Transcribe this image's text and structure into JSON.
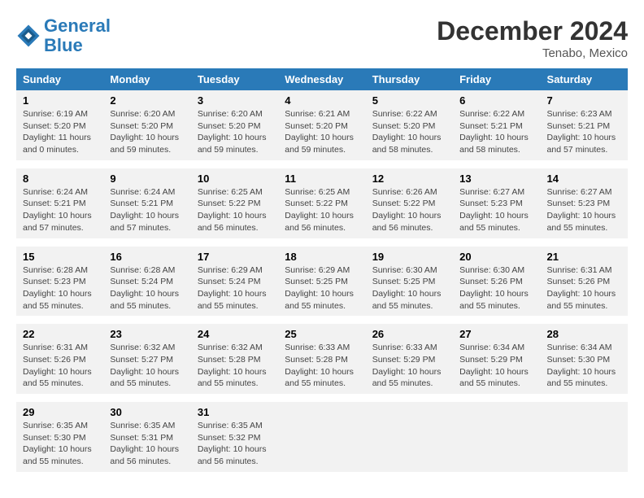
{
  "header": {
    "logo_line1": "General",
    "logo_line2": "Blue",
    "month": "December 2024",
    "location": "Tenabo, Mexico"
  },
  "weekdays": [
    "Sunday",
    "Monday",
    "Tuesday",
    "Wednesday",
    "Thursday",
    "Friday",
    "Saturday"
  ],
  "weeks": [
    [
      {
        "day": "1",
        "info": "Sunrise: 6:19 AM\nSunset: 5:20 PM\nDaylight: 11 hours\nand 0 minutes."
      },
      {
        "day": "2",
        "info": "Sunrise: 6:20 AM\nSunset: 5:20 PM\nDaylight: 10 hours\nand 59 minutes."
      },
      {
        "day": "3",
        "info": "Sunrise: 6:20 AM\nSunset: 5:20 PM\nDaylight: 10 hours\nand 59 minutes."
      },
      {
        "day": "4",
        "info": "Sunrise: 6:21 AM\nSunset: 5:20 PM\nDaylight: 10 hours\nand 59 minutes."
      },
      {
        "day": "5",
        "info": "Sunrise: 6:22 AM\nSunset: 5:20 PM\nDaylight: 10 hours\nand 58 minutes."
      },
      {
        "day": "6",
        "info": "Sunrise: 6:22 AM\nSunset: 5:21 PM\nDaylight: 10 hours\nand 58 minutes."
      },
      {
        "day": "7",
        "info": "Sunrise: 6:23 AM\nSunset: 5:21 PM\nDaylight: 10 hours\nand 57 minutes."
      }
    ],
    [
      {
        "day": "8",
        "info": "Sunrise: 6:24 AM\nSunset: 5:21 PM\nDaylight: 10 hours\nand 57 minutes."
      },
      {
        "day": "9",
        "info": "Sunrise: 6:24 AM\nSunset: 5:21 PM\nDaylight: 10 hours\nand 57 minutes."
      },
      {
        "day": "10",
        "info": "Sunrise: 6:25 AM\nSunset: 5:22 PM\nDaylight: 10 hours\nand 56 minutes."
      },
      {
        "day": "11",
        "info": "Sunrise: 6:25 AM\nSunset: 5:22 PM\nDaylight: 10 hours\nand 56 minutes."
      },
      {
        "day": "12",
        "info": "Sunrise: 6:26 AM\nSunset: 5:22 PM\nDaylight: 10 hours\nand 56 minutes."
      },
      {
        "day": "13",
        "info": "Sunrise: 6:27 AM\nSunset: 5:23 PM\nDaylight: 10 hours\nand 55 minutes."
      },
      {
        "day": "14",
        "info": "Sunrise: 6:27 AM\nSunset: 5:23 PM\nDaylight: 10 hours\nand 55 minutes."
      }
    ],
    [
      {
        "day": "15",
        "info": "Sunrise: 6:28 AM\nSunset: 5:23 PM\nDaylight: 10 hours\nand 55 minutes."
      },
      {
        "day": "16",
        "info": "Sunrise: 6:28 AM\nSunset: 5:24 PM\nDaylight: 10 hours\nand 55 minutes."
      },
      {
        "day": "17",
        "info": "Sunrise: 6:29 AM\nSunset: 5:24 PM\nDaylight: 10 hours\nand 55 minutes."
      },
      {
        "day": "18",
        "info": "Sunrise: 6:29 AM\nSunset: 5:25 PM\nDaylight: 10 hours\nand 55 minutes."
      },
      {
        "day": "19",
        "info": "Sunrise: 6:30 AM\nSunset: 5:25 PM\nDaylight: 10 hours\nand 55 minutes."
      },
      {
        "day": "20",
        "info": "Sunrise: 6:30 AM\nSunset: 5:26 PM\nDaylight: 10 hours\nand 55 minutes."
      },
      {
        "day": "21",
        "info": "Sunrise: 6:31 AM\nSunset: 5:26 PM\nDaylight: 10 hours\nand 55 minutes."
      }
    ],
    [
      {
        "day": "22",
        "info": "Sunrise: 6:31 AM\nSunset: 5:26 PM\nDaylight: 10 hours\nand 55 minutes."
      },
      {
        "day": "23",
        "info": "Sunrise: 6:32 AM\nSunset: 5:27 PM\nDaylight: 10 hours\nand 55 minutes."
      },
      {
        "day": "24",
        "info": "Sunrise: 6:32 AM\nSunset: 5:28 PM\nDaylight: 10 hours\nand 55 minutes."
      },
      {
        "day": "25",
        "info": "Sunrise: 6:33 AM\nSunset: 5:28 PM\nDaylight: 10 hours\nand 55 minutes."
      },
      {
        "day": "26",
        "info": "Sunrise: 6:33 AM\nSunset: 5:29 PM\nDaylight: 10 hours\nand 55 minutes."
      },
      {
        "day": "27",
        "info": "Sunrise: 6:34 AM\nSunset: 5:29 PM\nDaylight: 10 hours\nand 55 minutes."
      },
      {
        "day": "28",
        "info": "Sunrise: 6:34 AM\nSunset: 5:30 PM\nDaylight: 10 hours\nand 55 minutes."
      }
    ],
    [
      {
        "day": "29",
        "info": "Sunrise: 6:35 AM\nSunset: 5:30 PM\nDaylight: 10 hours\nand 55 minutes."
      },
      {
        "day": "30",
        "info": "Sunrise: 6:35 AM\nSunset: 5:31 PM\nDaylight: 10 hours\nand 56 minutes."
      },
      {
        "day": "31",
        "info": "Sunrise: 6:35 AM\nSunset: 5:32 PM\nDaylight: 10 hours\nand 56 minutes."
      },
      {
        "day": "",
        "info": ""
      },
      {
        "day": "",
        "info": ""
      },
      {
        "day": "",
        "info": ""
      },
      {
        "day": "",
        "info": ""
      }
    ]
  ]
}
